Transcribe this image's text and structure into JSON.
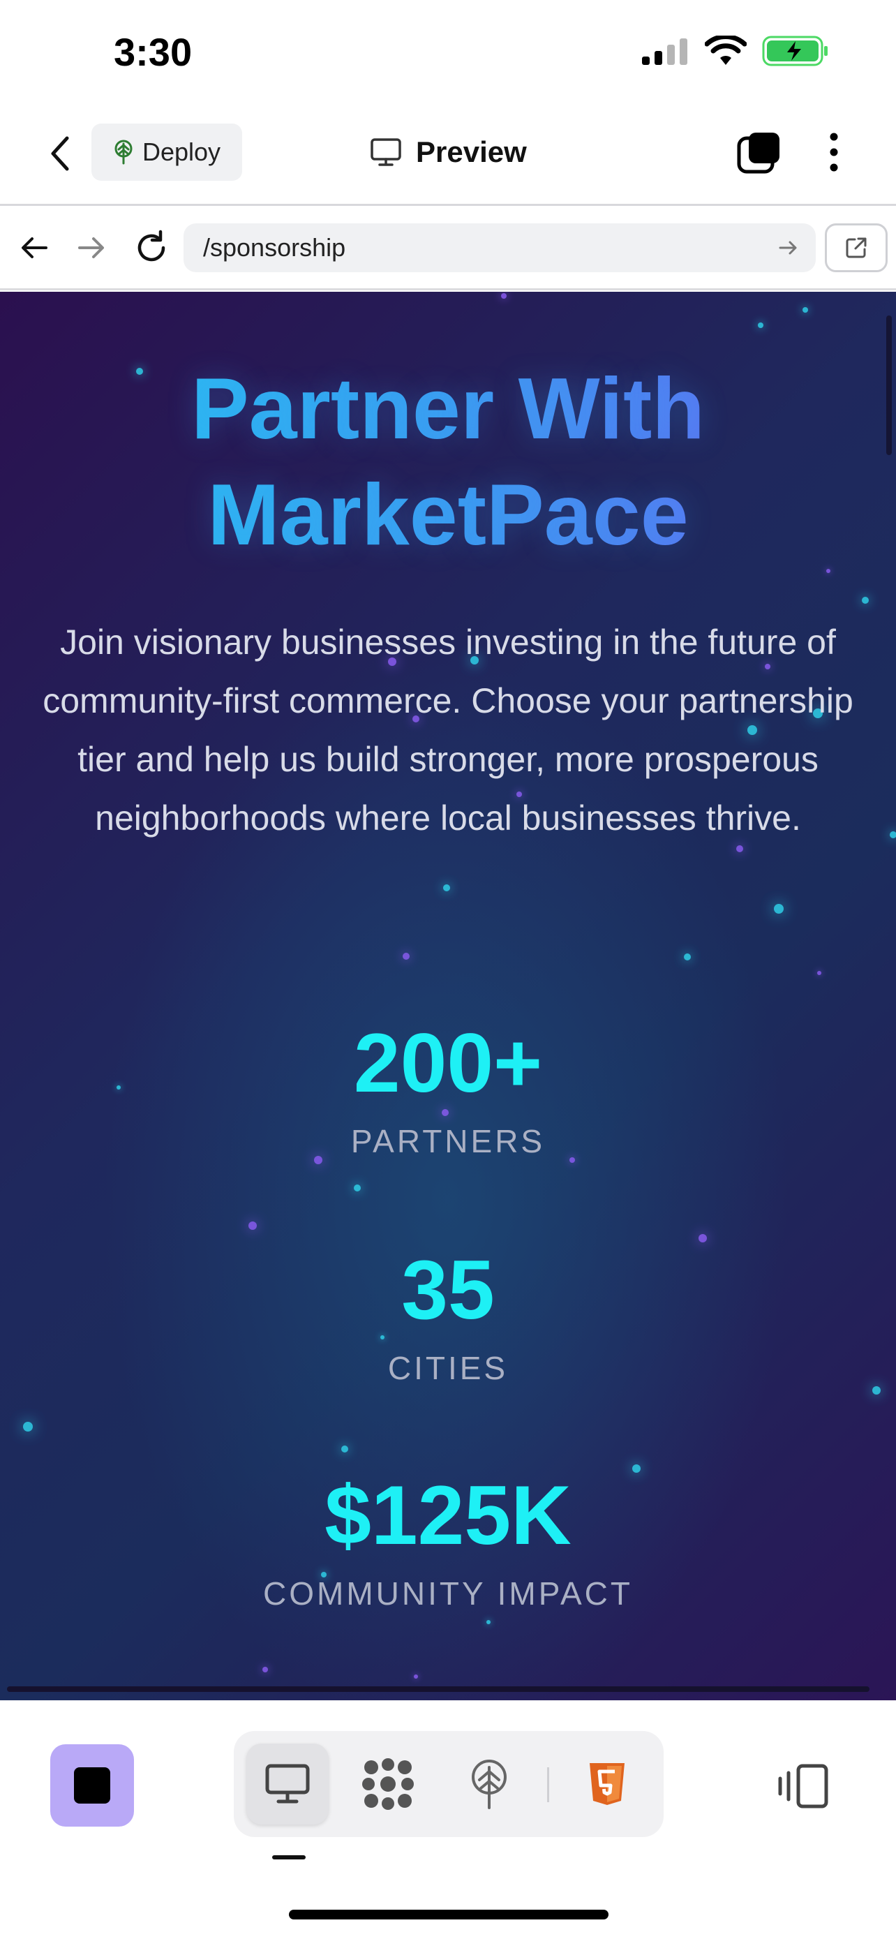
{
  "status_bar": {
    "time": "3:30"
  },
  "top_bar": {
    "deploy_label": "Deploy",
    "title": "Preview"
  },
  "browser": {
    "url": "/sponsorship"
  },
  "page": {
    "hero_title_line1": "Partner With",
    "hero_title_line2": "MarketPace",
    "hero_subtitle": "Join visionary businesses investing in the future of community-first commerce. Choose your partnership tier and help us build stronger, more prosperous neighborhoods where local businesses thrive.",
    "stats": [
      {
        "value": "200+",
        "label": "PARTNERS"
      },
      {
        "value": "35",
        "label": "CITIES"
      },
      {
        "value": "$125K",
        "label": "COMMUNITY IMPACT"
      }
    ]
  },
  "bottom_bar": {
    "tools": [
      "desktop-preview-icon",
      "apps-grid-icon",
      "deploy-tree-icon",
      "html5-icon"
    ]
  },
  "colors": {
    "accent_cyan": "#1ef0f5",
    "stop_button": "#b9a9f7",
    "html5_orange": "#e0641e"
  }
}
